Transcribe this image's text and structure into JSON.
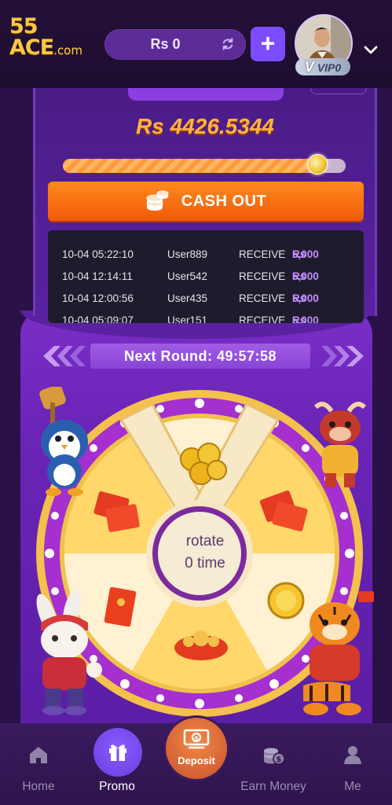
{
  "header": {
    "logo_top": "55",
    "logo_bottom": "ACE",
    "logo_suffix": ".com",
    "balance": "Rs 0",
    "plus_label": "+",
    "vip_label": "VIP0",
    "vip_prefix": "V"
  },
  "card": {
    "amount": "Rs 4426.5344",
    "progress_fraction": 0.89,
    "cashout_label": "CASH OUT"
  },
  "winners": [
    {
      "time": "10-04 05:22:10",
      "user": "User889",
      "action": "RECEIVE",
      "currency": "Rs",
      "amount": "5,000"
    },
    {
      "time": "10-04 12:14:11",
      "user": "User542",
      "action": "RECEIVE",
      "currency": "Rs",
      "amount": "5,000"
    },
    {
      "time": "10-04 12:00:56",
      "user": "User435",
      "action": "RECEIVE",
      "currency": "Rs",
      "amount": "5,000"
    },
    {
      "time": "10-04 05:09:07",
      "user": "User151",
      "action": "RECEIVE",
      "currency": "Rs",
      "amount": "5,000"
    }
  ],
  "wheel": {
    "next_round_label": "Next Round:",
    "next_round_time": "49:57:58",
    "rotate_line1": "rotate",
    "rotate_line2": "0 time"
  },
  "nav": {
    "home": "Home",
    "promo": "Promo",
    "deposit": "Deposit",
    "earn_money": "Earn Money",
    "me": "Me"
  },
  "colors": {
    "background": "#2a1147",
    "accent": "#7b4dff",
    "cashout": "#f26b12",
    "amount": "#ffb347"
  }
}
